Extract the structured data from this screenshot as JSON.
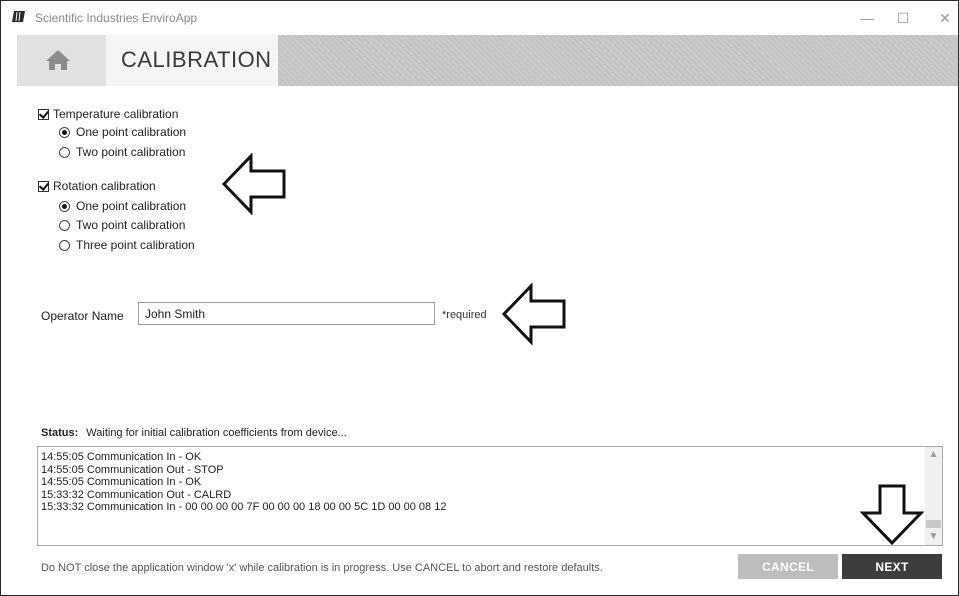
{
  "window": {
    "title": "Scientific Industries EnviroApp",
    "controls": {
      "minimize": "—",
      "maximize": "☐",
      "close": "✕"
    }
  },
  "header": {
    "title": "CALIBRATION",
    "home_icon": "home-icon"
  },
  "temperature": {
    "label": "Temperature calibration",
    "checked": true,
    "options": [
      {
        "label": "One point calibration",
        "selected": true
      },
      {
        "label": "Two point calibration",
        "selected": false
      }
    ]
  },
  "rotation": {
    "label": "Rotation calibration",
    "checked": true,
    "options": [
      {
        "label": "One point calibration",
        "selected": true
      },
      {
        "label": "Two point calibration",
        "selected": false
      },
      {
        "label": "Three point calibration",
        "selected": false
      }
    ]
  },
  "operator": {
    "label": "Operator Name",
    "value": "John Smith",
    "required_note": "*required"
  },
  "status": {
    "label": "Status:",
    "text": "Waiting for initial calibration coefficients from device..."
  },
  "log": [
    "14:55:05 Communication In - OK",
    "14:55:05 Communication Out - STOP",
    "14:55:05 Communication In - OK",
    "15:33:32 Communication Out - CALRD",
    "15:33:32 Communication In - 00 00 00 00 7F 00 00 00 18 00 00 5C 1D 00 00 08 12"
  ],
  "footer": {
    "note": "Do NOT close the application window 'x' while calibration is in progress. Use CANCEL to abort and restore defaults.",
    "cancel_label": "CANCEL",
    "next_label": "NEXT"
  },
  "colors": {
    "header_band": "#c9c9c9",
    "cancel_bg": "#bdbdbd",
    "next_bg": "#3d3d3d"
  }
}
